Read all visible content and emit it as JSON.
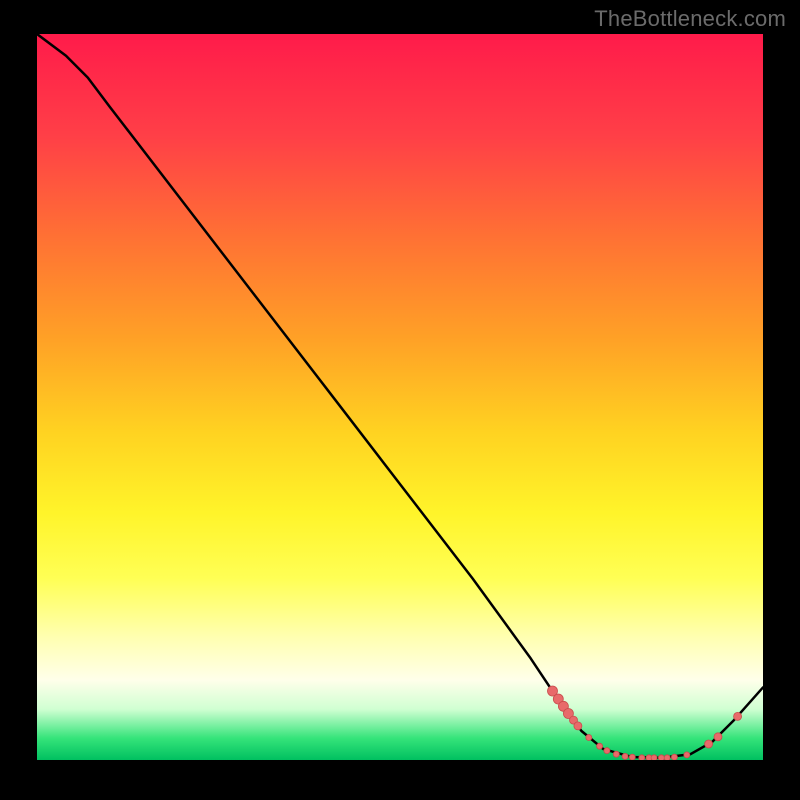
{
  "attribution": "TheBottleneck.com",
  "colors": {
    "curve_stroke": "#000000",
    "marker_fill": "#e86a6a",
    "marker_stroke": "#c94c4c"
  },
  "chart_data": {
    "type": "line",
    "title": "",
    "xlabel": "",
    "ylabel": "",
    "xlim": [
      0,
      100
    ],
    "ylim": [
      0,
      100
    ],
    "grid": false,
    "comment": "Bottleneck curve. x = relative performance index (0–100), y = bottleneck severity (0 = none, 100 = max). Minimum sits ~x 80–90.",
    "curve": [
      {
        "x": 0,
        "y": 100
      },
      {
        "x": 4,
        "y": 97
      },
      {
        "x": 7,
        "y": 94
      },
      {
        "x": 10,
        "y": 90
      },
      {
        "x": 20,
        "y": 77
      },
      {
        "x": 30,
        "y": 64
      },
      {
        "x": 40,
        "y": 51
      },
      {
        "x": 50,
        "y": 38
      },
      {
        "x": 60,
        "y": 25
      },
      {
        "x": 68,
        "y": 14
      },
      {
        "x": 72,
        "y": 8
      },
      {
        "x": 75,
        "y": 4
      },
      {
        "x": 78,
        "y": 1.5
      },
      {
        "x": 82,
        "y": 0.4
      },
      {
        "x": 86,
        "y": 0.3
      },
      {
        "x": 90,
        "y": 0.8
      },
      {
        "x": 93,
        "y": 2.5
      },
      {
        "x": 96,
        "y": 5.5
      },
      {
        "x": 100,
        "y": 10
      }
    ],
    "markers": [
      {
        "x": 71.0,
        "y": 9.5,
        "r": 5
      },
      {
        "x": 71.8,
        "y": 8.4,
        "r": 5
      },
      {
        "x": 72.5,
        "y": 7.4,
        "r": 5
      },
      {
        "x": 73.2,
        "y": 6.4,
        "r": 5
      },
      {
        "x": 73.9,
        "y": 5.5,
        "r": 4
      },
      {
        "x": 74.5,
        "y": 4.7,
        "r": 4
      },
      {
        "x": 76.0,
        "y": 3.1,
        "r": 3
      },
      {
        "x": 77.5,
        "y": 1.9,
        "r": 3
      },
      {
        "x": 78.5,
        "y": 1.3,
        "r": 3
      },
      {
        "x": 79.8,
        "y": 0.8,
        "r": 3
      },
      {
        "x": 81.0,
        "y": 0.5,
        "r": 3
      },
      {
        "x": 82.0,
        "y": 0.4,
        "r": 3
      },
      {
        "x": 83.3,
        "y": 0.3,
        "r": 3
      },
      {
        "x": 84.3,
        "y": 0.3,
        "r": 3
      },
      {
        "x": 85.0,
        "y": 0.3,
        "r": 3
      },
      {
        "x": 86.0,
        "y": 0.3,
        "r": 3
      },
      {
        "x": 86.8,
        "y": 0.3,
        "r": 3
      },
      {
        "x": 87.8,
        "y": 0.4,
        "r": 3
      },
      {
        "x": 89.5,
        "y": 0.7,
        "r": 3
      },
      {
        "x": 92.5,
        "y": 2.2,
        "r": 4
      },
      {
        "x": 93.8,
        "y": 3.2,
        "r": 4
      },
      {
        "x": 96.5,
        "y": 6.0,
        "r": 4
      }
    ]
  }
}
